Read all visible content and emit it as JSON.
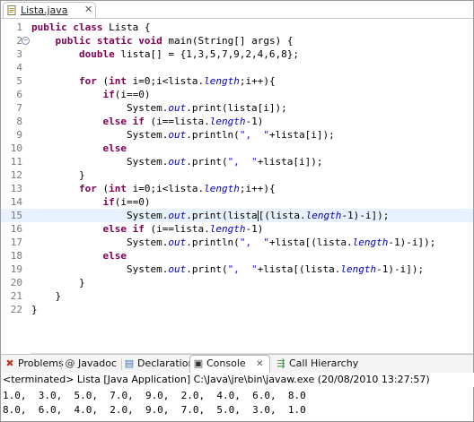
{
  "editor_tab": {
    "label": "Lista.java",
    "close": "✕"
  },
  "code_lines": [
    "public class Lista {",
    "    public static void main(String[] args) {",
    "        double lista[] = {1,3,5,7,9,2,4,6,8};",
    "",
    "        for (int i=0;i<lista.length;i++){",
    "            if(i==0)",
    "                System.out.print(lista[i]);",
    "            else if (i==lista.length-1)",
    "                System.out.println(\",  \"+lista[i]);",
    "            else",
    "                System.out.print(\",  \"+lista[i]);",
    "        }",
    "        for (int i=0;i<lista.length;i++){",
    "            if(i==0)",
    "                System.out.print(lista[(lista.length-1)-i]);",
    "            else if (i==lista.length-1)",
    "                System.out.println(\",  \"+lista[(lista.length-1)-i]);",
    "            else",
    "                System.out.print(\",  \"+lista[(lista.length-1)-i]);",
    "        }",
    "    }",
    "}"
  ],
  "views": {
    "problems": "Problems",
    "javadoc": "Javadoc",
    "declaration": "Declaration",
    "console": "Console",
    "console_close": "✕",
    "call_hierarchy": "Call Hierarchy"
  },
  "console": {
    "header": "<terminated> Lista [Java Application] C:\\Java\\jre\\bin\\javaw.exe (20/08/2010 13:27:57)",
    "output": [
      "1.0,  3.0,  5.0,  7.0,  9.0,  2.0,  4.0,  6.0,  8.0",
      "8.0,  6.0,  4.0,  2.0,  9.0,  7.0,  5.0,  3.0,  1.0"
    ]
  },
  "colors": {
    "keyword": "#7f0055",
    "field": "#0000c0",
    "string": "#2a00ff",
    "current_line": "#e8f2fe"
  }
}
